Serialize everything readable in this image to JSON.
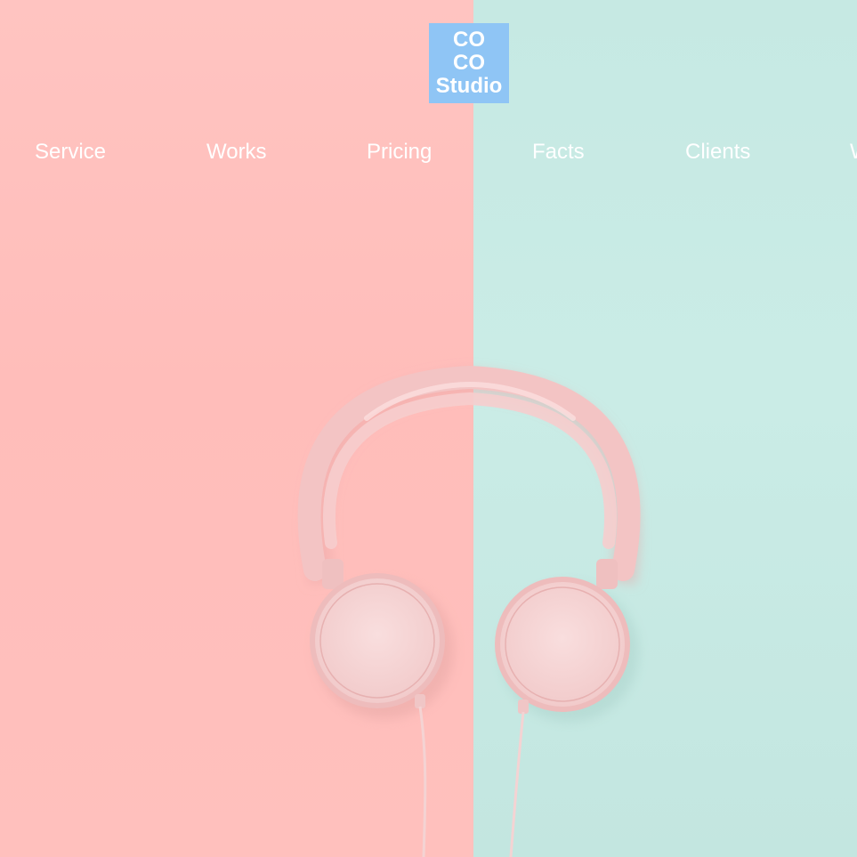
{
  "logo": {
    "text": "CO\nCO\nStudio",
    "color": "#8fc5f5"
  },
  "nav": {
    "items": [
      {
        "label": "Service"
      },
      {
        "label": "Works"
      },
      {
        "label": "Pricing"
      },
      {
        "label": "Facts"
      },
      {
        "label": "Clients"
      },
      {
        "label": "W"
      }
    ]
  },
  "hero": {
    "left_color": "#ffc0bd",
    "right_color": "#c8eae4",
    "headphones_color": "#f7cfcf"
  }
}
